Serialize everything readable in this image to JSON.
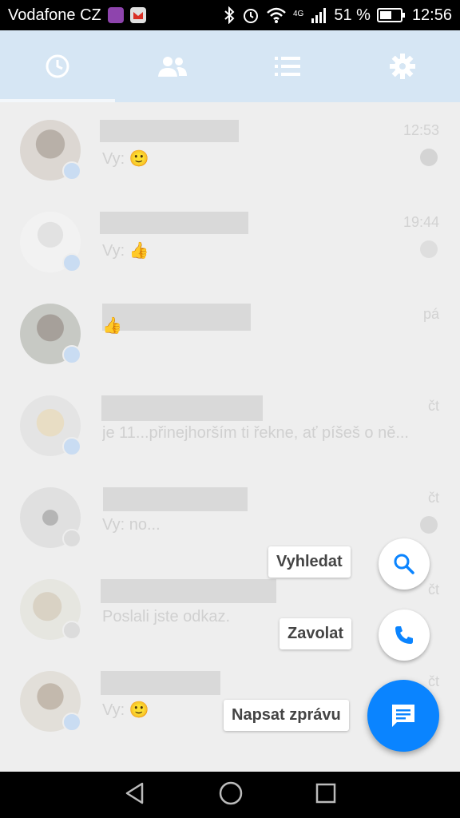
{
  "status_bar": {
    "carrier": "Vodafone CZ",
    "network": "4G",
    "battery_percent": "51 %",
    "time": "12:56"
  },
  "tabs": [
    {
      "name": "recent",
      "icon": "clock-icon",
      "active": true
    },
    {
      "name": "people",
      "icon": "people-icon",
      "active": false
    },
    {
      "name": "groups",
      "icon": "list-icon",
      "active": false
    },
    {
      "name": "settings",
      "icon": "gear-icon",
      "active": false
    }
  ],
  "conversations": [
    {
      "preview": "Vy: 🙂",
      "time": "12:53",
      "badge": "messenger"
    },
    {
      "preview": "Vy: 👍",
      "time": "19:44",
      "badge": "messenger"
    },
    {
      "preview": "👍",
      "time": "pá",
      "badge": "messenger"
    },
    {
      "preview": "je 11...přinejhorším ti řekne, ať píšeš o ně...",
      "time": "čt",
      "badge": "messenger"
    },
    {
      "preview": "Vy: no...",
      "time": "čt",
      "badge": "facebook"
    },
    {
      "preview": "Poslali jste odkaz.",
      "time": "čt",
      "badge": "facebook"
    },
    {
      "preview": "Vy: 🙂",
      "time": "čt",
      "badge": "messenger"
    }
  ],
  "speed_dial": {
    "search_label": "Vyhledat",
    "call_label": "Zavolat",
    "compose_label": "Napsat zprávu"
  },
  "colors": {
    "accent": "#0a84ff",
    "tabbar": "#d6e6f4"
  }
}
